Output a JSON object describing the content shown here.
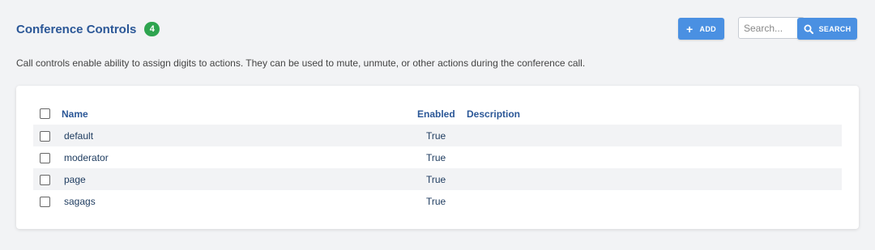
{
  "header": {
    "title": "Conference Controls",
    "count": "4",
    "add_label": "ADD",
    "search_placeholder": "Search...",
    "search_label": "SEARCH",
    "description": "Call controls enable ability to assign digits to actions. They can be used to mute, unmute, or other actions during the conference call."
  },
  "table": {
    "columns": {
      "name": "Name",
      "enabled": "Enabled",
      "description": "Description"
    },
    "rows": [
      {
        "name": "default",
        "enabled": "True",
        "description": ""
      },
      {
        "name": "moderator",
        "enabled": "True",
        "description": ""
      },
      {
        "name": "page",
        "enabled": "True",
        "description": ""
      },
      {
        "name": "sagags",
        "enabled": "True",
        "description": ""
      }
    ]
  },
  "icons": {
    "add": "plus-icon",
    "search": "magnifier-icon"
  },
  "colors": {
    "accent": "#4a90e2",
    "title": "#2b5797",
    "badge": "#2ea44f"
  }
}
